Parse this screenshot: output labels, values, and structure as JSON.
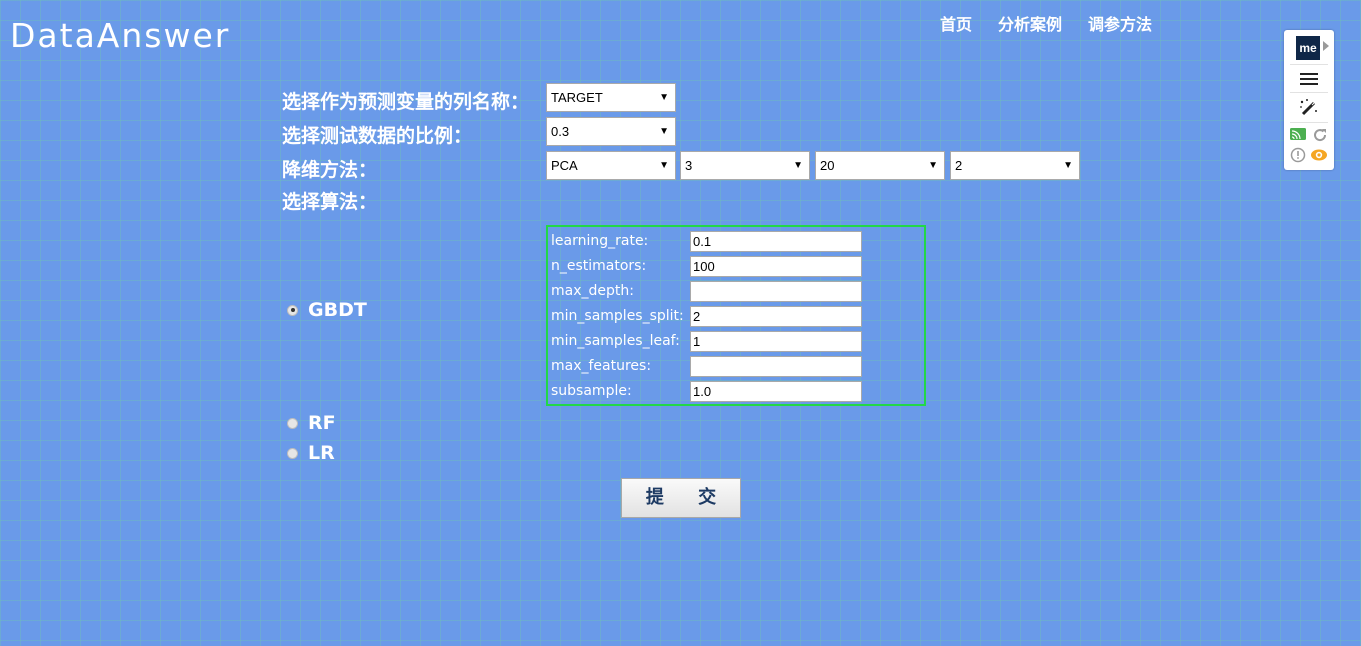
{
  "logo": "DataAnswer",
  "nav": [
    "首页",
    "分析案例",
    "调参方法"
  ],
  "form": {
    "target_label": "选择作为预测变量的列名称：",
    "target_value": "TARGET",
    "test_ratio_label": "选择测试数据的比例：",
    "test_ratio_value": "0.3",
    "dim_reduction_label": "降维方法：",
    "dim_reduction": [
      "PCA",
      "3",
      "20",
      "2"
    ],
    "algorithm_label": "选择算法："
  },
  "params": [
    {
      "label": "learning_rate:",
      "value": "0.1"
    },
    {
      "label": "n_estimators:",
      "value": "100"
    },
    {
      "label": "max_depth:",
      "value": ""
    },
    {
      "label": "min_samples_split:",
      "value": "2"
    },
    {
      "label": "min_samples_leaf:",
      "value": "1"
    },
    {
      "label": "max_features:",
      "value": ""
    },
    {
      "label": "subsample:",
      "value": "1.0"
    }
  ],
  "algorithms": [
    {
      "label": "GBDT",
      "selected": true
    },
    {
      "label": "RF",
      "selected": false
    },
    {
      "label": "LR",
      "selected": false
    }
  ],
  "submit_label": "提 交",
  "extension": {
    "logo_text": "me",
    "icons": [
      "menu-icon",
      "magic-wand-icon",
      "cast-icon",
      "refresh-icon",
      "info-icon",
      "eye-icon"
    ]
  },
  "colors": {
    "background": "#6a9ae9",
    "params_border": "#22d846",
    "submit_text": "#1d3a63"
  }
}
